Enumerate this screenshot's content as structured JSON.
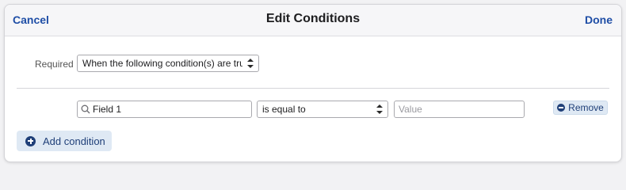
{
  "header": {
    "cancel_label": "Cancel",
    "title": "Edit Conditions",
    "done_label": "Done"
  },
  "required": {
    "label": "Required",
    "selected": "When the following condition(s) are true"
  },
  "condition": {
    "field_value": "Field 1",
    "operator_selected": "is equal to",
    "value_placeholder": "Value",
    "remove_label": "Remove"
  },
  "add_condition_label": "Add condition",
  "icons": {
    "search": "search-icon",
    "remove": "minus-circle-icon",
    "add": "plus-circle-icon",
    "select_arrows": "up-down-arrows-icon"
  },
  "colors": {
    "accent": "#1f4ea6",
    "button_bg": "#dfe9f4",
    "button_text": "#1f3f78"
  }
}
